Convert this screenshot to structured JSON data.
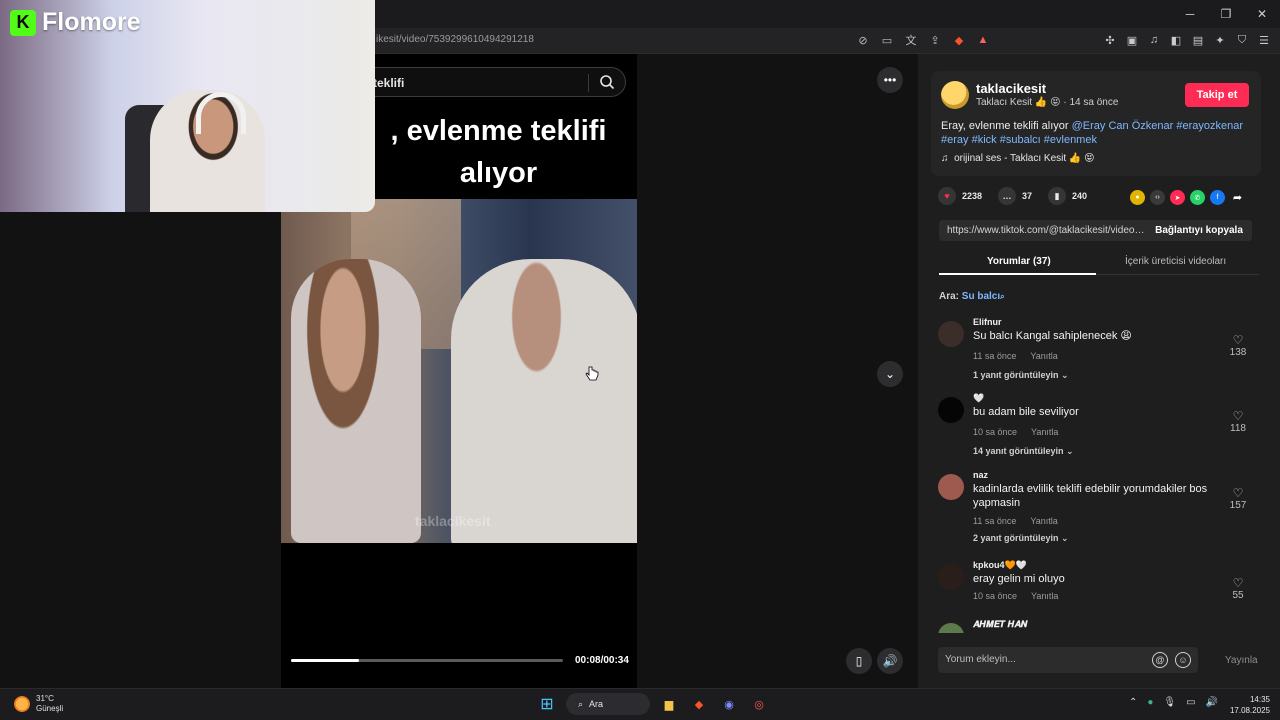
{
  "browser": {
    "url": "ikesit/video/7539299610494291218",
    "window_controls": [
      "─",
      "❐",
      "✕"
    ]
  },
  "overlay": {
    "logo_letter": "K",
    "logo_text": "Flomore"
  },
  "player": {
    "search_query": "teklifi",
    "caption": ", evlenme teklifi alıyor",
    "watermark": "taklacikesit",
    "time": "00:08/00:34",
    "progress": 0.25
  },
  "post": {
    "username": "taklacikesit",
    "subline": "Taklacı Kesit 👍 😝 · 14 sa önce",
    "follow_label": "Takip et",
    "desc_text": "Eray, evlenme teklifi alıyor ",
    "tags": [
      "@Eray Can Özkenar",
      "#erayozkenar",
      "#eray",
      "#kick",
      "#subalcı",
      "#evlenmek"
    ],
    "sound_icon": "♫",
    "sound": "orijinal ses - Taklacı Kesit 👍 😝",
    "likes": "2238",
    "comments": "37",
    "saves": "240",
    "link": "https://www.tiktok.com/@taklacikesit/video/...",
    "copy_label": "Bağlantıyı kopyala"
  },
  "tabs": {
    "comments": "Yorumlar (37)",
    "creator": "İçerik üreticisi videoları"
  },
  "search_hint": {
    "label": "Ara: ",
    "query": "Su balcı"
  },
  "comments": [
    {
      "name": "Elifnur",
      "text": "Su balcı Kangal sahiplenecek 😩",
      "time": "11 sa önce",
      "reply": "Yanıtla",
      "replies": "1 yanıt görüntüleyin ⌄",
      "likes": "138",
      "avatar_color": "#3b2d2a"
    },
    {
      "name": "🤍",
      "text": "bu adam bile seviliyor",
      "time": "10 sa önce",
      "reply": "Yanıtla",
      "replies": "14 yanıt görüntüleyin ⌄",
      "likes": "118",
      "avatar_color": "#050505"
    },
    {
      "name": "naz",
      "text": "kadinlarda evlilik teklifi edebilir yorumdakiler bos yapmasin",
      "time": "11 sa önce",
      "reply": "Yanıtla",
      "replies": "2 yanıt görüntüleyin ⌄",
      "likes": "157",
      "avatar_color": "#9e5a4e"
    },
    {
      "name": "kpkou4🧡🤍",
      "text": "eray gelin mi oluyo",
      "time": "10 sa önce",
      "reply": "Yanıtla",
      "replies": "",
      "likes": "55",
      "avatar_color": "#2a1e1a"
    },
    {
      "name": "𝑨𝑯𝑴𝑬𝑻 𝑯𝑨𝑵",
      "text": "",
      "time": "",
      "reply": "",
      "replies": "",
      "likes": "",
      "avatar_color": "#5d7a4a"
    }
  ],
  "composer": {
    "placeholder": "Yorum ekleyin...",
    "post_label": "Yayınla"
  },
  "taskbar": {
    "temp": "31°C",
    "weather": "Güneşli",
    "search": "Ara",
    "time": "14:35",
    "date": "17.08.2025"
  }
}
